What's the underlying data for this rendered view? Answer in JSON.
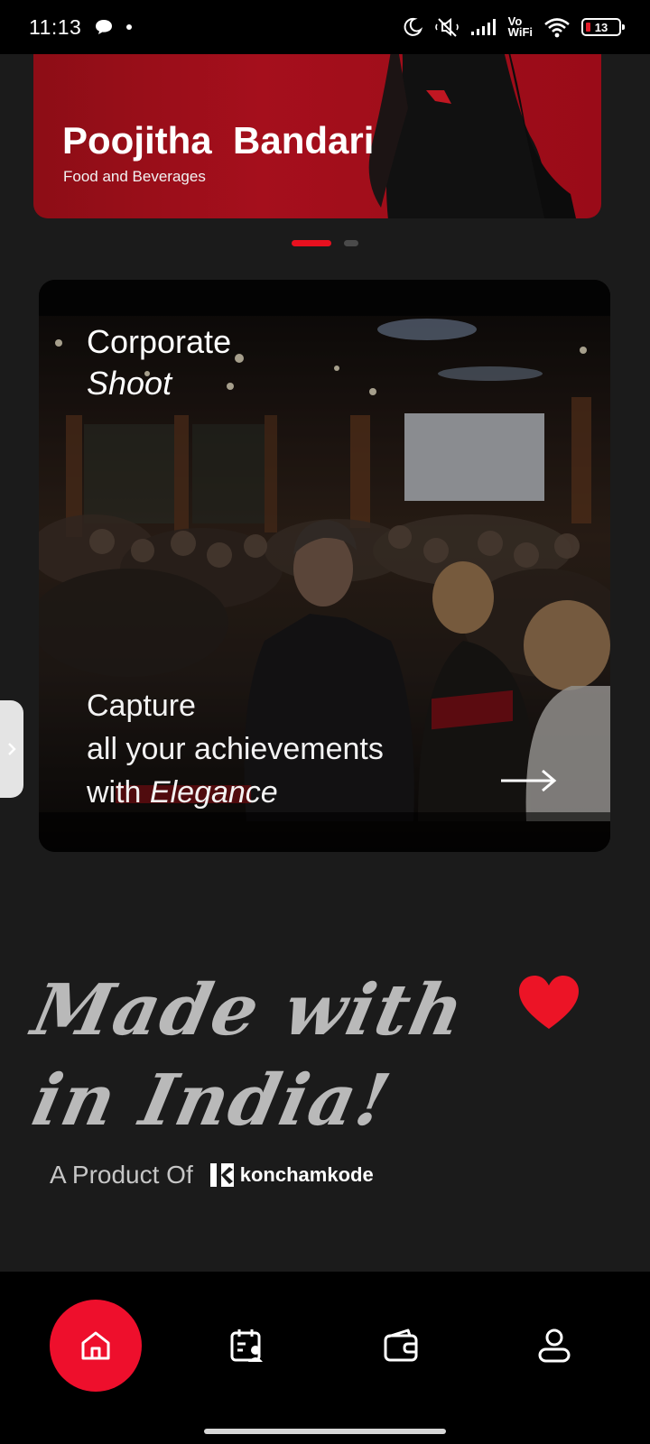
{
  "status_bar": {
    "time": "11:13",
    "icons": [
      "chat-bubble-icon",
      "moon-icon",
      "mute-icon",
      "signal-icon",
      "vowifi-icon",
      "wifi-icon",
      "battery-icon"
    ],
    "vowifi_top": "Vo",
    "vowifi_bottom": "WiFi",
    "battery_level": "13"
  },
  "banner": {
    "name": "Poojitha  Bandari",
    "category": "Food and Beverages",
    "pager": {
      "active_index": 0,
      "count": 2
    }
  },
  "card": {
    "title_line1": "Corporate",
    "title_line2": "Shoot",
    "caption_line1": "Capture",
    "caption_line2": "all your achievements",
    "caption_line3_prefix": "with ",
    "caption_line3_emphasis": "Elegance"
  },
  "made_in": {
    "line1": "Made with",
    "line2": "in India!",
    "heart_color": "#ec1426"
  },
  "product": {
    "label": "A Product Of",
    "brand": "konchamkode"
  },
  "bottom_nav": {
    "items": [
      {
        "icon": "home-icon",
        "active": true
      },
      {
        "icon": "calendar-user-icon",
        "active": false
      },
      {
        "icon": "wallet-icon",
        "active": false
      },
      {
        "icon": "profile-icon",
        "active": false
      }
    ],
    "accent": "#ee0f2c"
  }
}
